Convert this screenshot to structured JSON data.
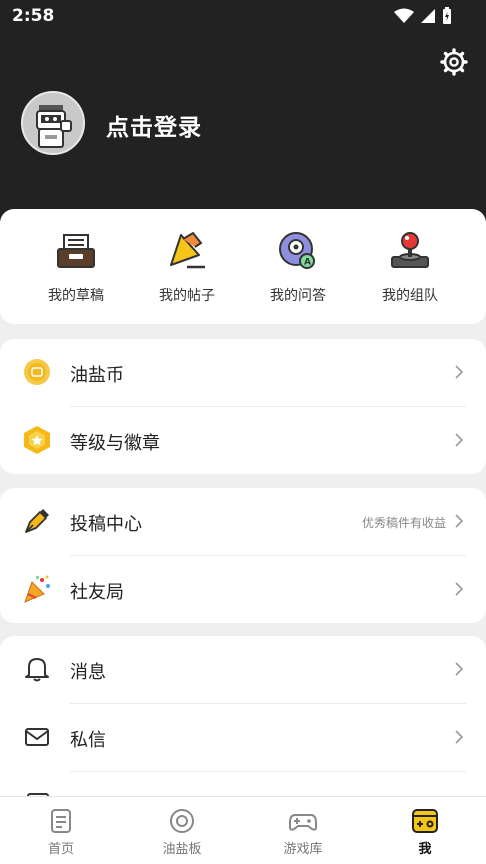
{
  "status": {
    "time": "2:58"
  },
  "profile": {
    "login_label": "点击登录"
  },
  "quick_actions": [
    {
      "label": "我的草稿",
      "icon": "drafts-icon"
    },
    {
      "label": "我的帖子",
      "icon": "posts-icon"
    },
    {
      "label": "我的问答",
      "icon": "qa-icon"
    },
    {
      "label": "我的组队",
      "icon": "joystick-icon"
    }
  ],
  "section1": [
    {
      "label": "油盐币",
      "icon": "coin-icon"
    },
    {
      "label": "等级与徽章",
      "icon": "badge-icon"
    }
  ],
  "section2": [
    {
      "label": "投稿中心",
      "hint": "优秀稿件有收益",
      "icon": "pen-icon"
    },
    {
      "label": "社友局",
      "icon": "party-popper-icon"
    }
  ],
  "section3": [
    {
      "label": "消息",
      "icon": "bell-icon"
    },
    {
      "label": "私信",
      "icon": "mail-icon"
    }
  ],
  "tabs": [
    {
      "label": "首页",
      "icon": "home-doc-icon"
    },
    {
      "label": "油盐板",
      "icon": "board-icon"
    },
    {
      "label": "游戏库",
      "icon": "gamepad-icon"
    },
    {
      "label": "我",
      "icon": "me-icon",
      "active": true
    }
  ],
  "colors": {
    "header_bg": "#222222",
    "accent_yellow": "#f5c518",
    "page_bg": "#efefef"
  }
}
